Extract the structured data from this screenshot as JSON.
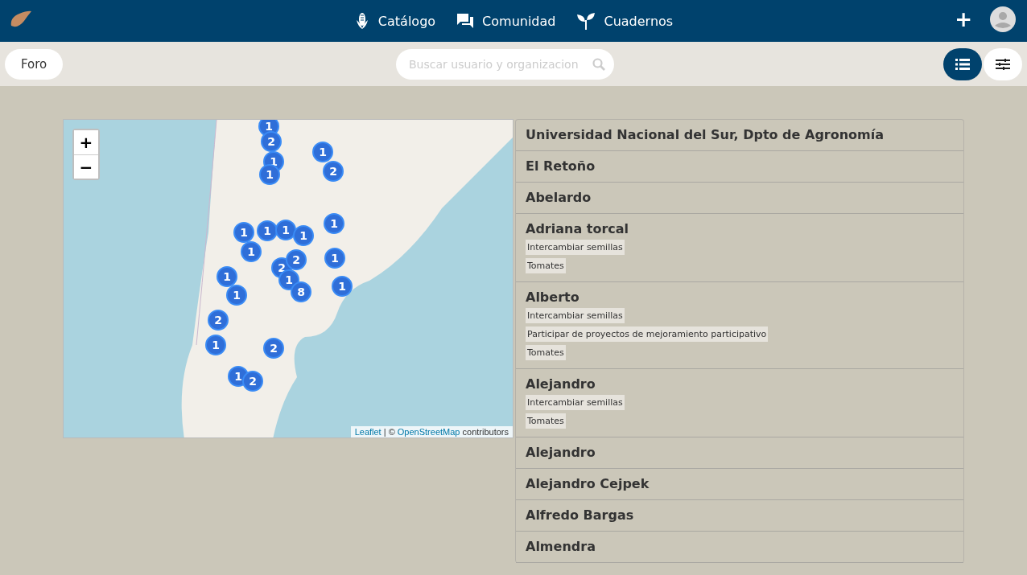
{
  "nav": {
    "items": [
      {
        "label": "Catálogo",
        "kind": "corn"
      },
      {
        "label": "Comunidad",
        "kind": "chat"
      },
      {
        "label": "Cuadernos",
        "kind": "sprout"
      }
    ],
    "add_button": "+"
  },
  "toolbar": {
    "forum_button": "Foro",
    "search": {
      "placeholder": "Buscar usuario y organizacion"
    },
    "view_buttons": [
      {
        "kind": "list",
        "selected": true
      },
      {
        "kind": "filters",
        "selected": false
      }
    ]
  },
  "map": {
    "zoom_in": "+",
    "zoom_out": "−",
    "markers": [
      "1",
      "2",
      "1",
      "1",
      "1",
      "2",
      "1",
      "1",
      "1",
      "1",
      "1",
      "1",
      "2",
      "2",
      "1",
      "1",
      "8",
      "1",
      "1",
      "1",
      "2",
      "1",
      "2",
      "1",
      "2"
    ],
    "attribution": {
      "link1": "Leaflet",
      "sep": " | © ",
      "link2": "OpenStreetMap",
      "rest": " contributors"
    }
  },
  "list": [
    {
      "name": "Universidad Nacional del Sur, Dpto de Agronomía"
    },
    {
      "name": "El Retoño"
    },
    {
      "name": "Abelardo"
    },
    {
      "name": "Adriana torcal",
      "tags": [
        "Intercambiar semillas",
        "Tomates"
      ]
    },
    {
      "name": "Alberto",
      "tags": [
        "Intercambiar semillas",
        "Participar de proyectos de mejoramiento participativo",
        "Tomates"
      ]
    },
    {
      "name": "Alejandro",
      "tags": [
        "Intercambiar semillas",
        "Tomates"
      ]
    },
    {
      "name": "Alejandro"
    },
    {
      "name": "Alejandro Cejpek"
    },
    {
      "name": "Alfredo Bargas"
    },
    {
      "name": "Almendra"
    }
  ]
}
